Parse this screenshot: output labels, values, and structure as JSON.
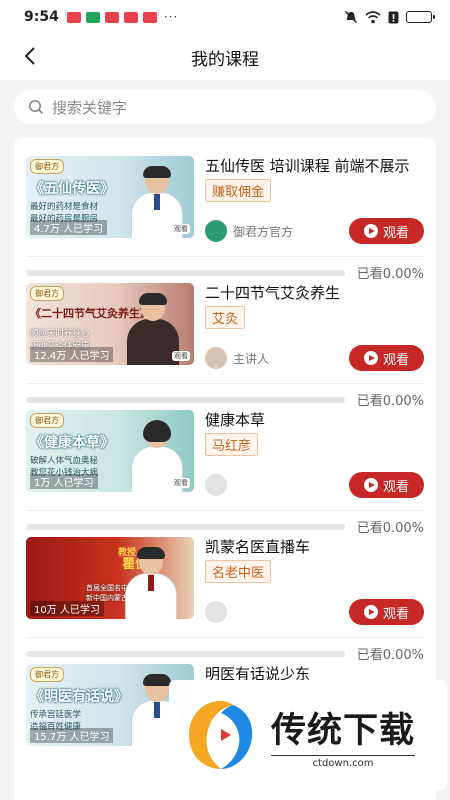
{
  "status_bar": {
    "time": "9:54",
    "dots": "···"
  },
  "header": {
    "title": "我的课程"
  },
  "search": {
    "placeholder": "搜索关键字"
  },
  "courses": [
    {
      "name": "五仙传医 培训课程 前端不展示",
      "tag": "赚取佣金",
      "author": "御君方官方",
      "watch_label": "观看",
      "progress_label": "已看0.00%",
      "progress": 0,
      "thumb": {
        "badge": "御君方",
        "title": "《五仙传医》",
        "sub1": "最好的药材是食材",
        "sub2": "最好的药房是厨房",
        "count": "4.7万 人已学习",
        "corner": "观看"
      }
    },
    {
      "name": "二十四节气艾灸养生",
      "tag": "艾灸",
      "author": "主讲人",
      "watch_label": "观看",
      "progress_label": "已看0.00%",
      "progress": 0,
      "thumb": {
        "badge": "御君方",
        "title": "《二十四节气艾灸养生》",
        "sub1": "顺应天时养身心",
        "sub2": "正确艾灸体安康",
        "count": "12.4万 人已学习",
        "corner": "观看"
      }
    },
    {
      "name": "健康本草",
      "tag": "马红彦",
      "author": "",
      "watch_label": "观看",
      "progress_label": "已看0.00%",
      "progress": 0,
      "thumb": {
        "badge": "御君方",
        "title": "《健康本草》",
        "sub1": "破解人体气血奥秘",
        "sub2": "教您花小钱治大病",
        "count": "1万 人已学习",
        "corner": "观看"
      }
    },
    {
      "name": "凯蒙名医直播车",
      "tag": "名老中医",
      "author": "",
      "watch_label": "观看",
      "progress_label": "已看0.00%",
      "progress": 0,
      "thumb": {
        "badge": "教授",
        "title": "瞿佳滨",
        "sub1": "首届全国名中医",
        "sub2": "新中国内蒙古医科大学学院",
        "count": "10万 人已学习",
        "corner": ""
      }
    },
    {
      "name": "明医有话说少东",
      "tag": "",
      "author": "",
      "watch_label": "",
      "progress_label": "",
      "progress": 0,
      "thumb": {
        "badge": "御君方",
        "title": "《明医有话说》",
        "sub1": "传承宫廷医学",
        "sub2": "造福百姓健康",
        "count": "15.7万 人已学习",
        "corner": ""
      }
    }
  ],
  "watermark": {
    "title": "传统下载",
    "url": "ctdown.com"
  },
  "colors": {
    "accent": "#c62828",
    "tag_text": "#c4661e",
    "background": "#f4f4f4"
  }
}
